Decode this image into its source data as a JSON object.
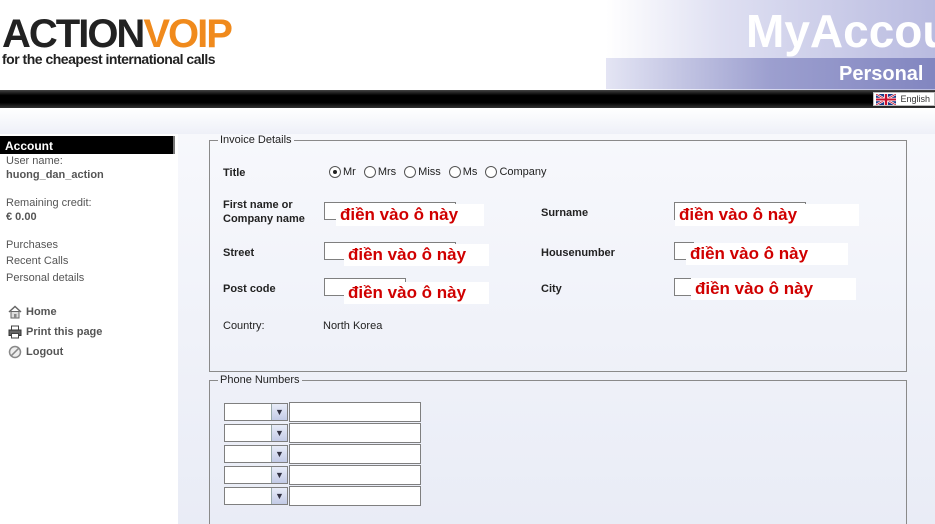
{
  "header": {
    "logo_action": "ACTION",
    "logo_voip": "VOIP",
    "tagline": "for the cheapest international calls",
    "title": "MyAccou",
    "subtitle": "Personal",
    "language": "English"
  },
  "sidebar": {
    "heading": "Account",
    "username_label": "User name:",
    "username": "huong_dan_action",
    "credit_label": "Remaining credit:",
    "credit": "€ 0.00",
    "links": [
      "Purchases",
      "Recent Calls",
      "Personal details"
    ],
    "nav": [
      {
        "label": "Home",
        "icon": "home-icon"
      },
      {
        "label": "Print this page",
        "icon": "printer-icon"
      },
      {
        "label": "Logout",
        "icon": "logout-icon"
      }
    ]
  },
  "invoice": {
    "legend": "Invoice Details",
    "title_label": "Title",
    "title_options": [
      "Mr",
      "Mrs",
      "Miss",
      "Ms",
      "Company"
    ],
    "title_selected": "Mr",
    "firstname_label": "First name or Company name",
    "surname_label": "Surname",
    "street_label": "Street",
    "housenumber_label": "Housenumber",
    "postcode_label": "Post code",
    "city_label": "City",
    "country_label": "Country:",
    "country_value": "North Korea",
    "hint": "điền vào ô này"
  },
  "phone": {
    "legend": "Phone Numbers"
  },
  "colors": {
    "brand_orange": "#f08a1c",
    "hint_red": "#d00000",
    "header_purple": "#8286c0"
  }
}
